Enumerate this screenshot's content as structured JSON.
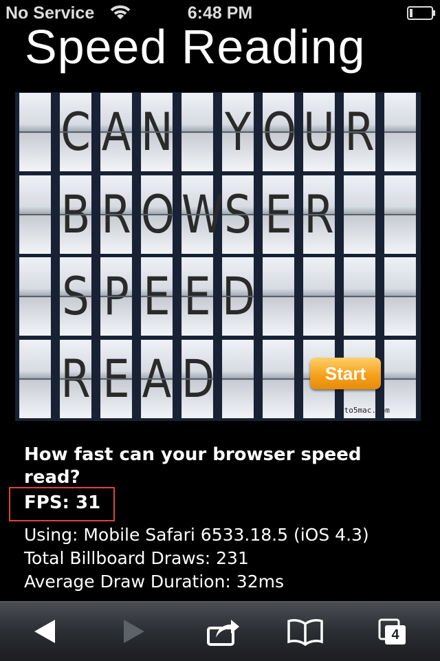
{
  "status_bar": {
    "carrier": "No Service",
    "time": "6:48 PM"
  },
  "page": {
    "title": "Speed Reading"
  },
  "board": {
    "rows": [
      [
        "",
        "C",
        "A",
        "N",
        "",
        "Y",
        "O",
        "U",
        "R",
        ""
      ],
      [
        "",
        "B",
        "R",
        "O",
        "W",
        "S",
        "E",
        "R",
        "",
        ""
      ],
      [
        "",
        "S",
        "P",
        "E",
        "E",
        "D",
        "",
        "",
        "",
        ""
      ],
      [
        "",
        "R",
        "E",
        "A",
        "D",
        "",
        "",
        "",
        "",
        ""
      ]
    ],
    "start_label": "Start",
    "watermark": "9to5mac.com"
  },
  "stats": {
    "question": "How fast can your browser speed read?",
    "fps": "FPS: 31",
    "using": "Using: Mobile Safari 6533.18.5 (iOS 4.3)",
    "draws": "Total Billboard Draws: 231",
    "duration": "Average Draw Duration: 32ms"
  },
  "toolbar": {
    "back_icon": "back-arrow-icon",
    "forward_icon": "forward-arrow-icon",
    "share_icon": "share-icon",
    "bookmarks_icon": "bookmarks-book-icon",
    "tabs_icon": "tabs-icon",
    "tabs_count": "4"
  },
  "colors": {
    "highlight_border": "#e0443a",
    "start_button": "#f5a21c"
  }
}
